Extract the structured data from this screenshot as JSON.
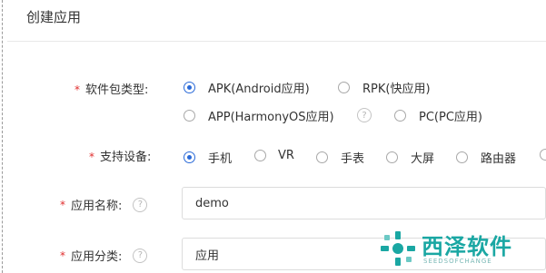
{
  "page": {
    "title": "创建应用"
  },
  "required_mark": "*",
  "package_type": {
    "label": "软件包类型:",
    "options": [
      {
        "label": "APK(Android应用)",
        "checked": true
      },
      {
        "label": "RPK(快应用)",
        "checked": false
      },
      {
        "label": "APP(HarmonyOS应用)",
        "checked": false
      },
      {
        "label": "PC(PC应用)",
        "checked": false
      }
    ],
    "help_icon": "?"
  },
  "devices": {
    "label": "支持设备:",
    "options": [
      {
        "label": "手机",
        "checked": true
      },
      {
        "label": "VR",
        "checked": false
      },
      {
        "label": "手表",
        "checked": false
      },
      {
        "label": "大屏",
        "checked": false
      },
      {
        "label": "路由器",
        "checked": false
      }
    ]
  },
  "app_name": {
    "label": "应用名称:",
    "help_icon": "?",
    "value": "demo"
  },
  "app_category": {
    "label": "应用分类:",
    "help_icon": "?",
    "value": "应用"
  },
  "watermark": {
    "brand": "西泽软件",
    "sub": "SEEDSOFCHANGE",
    "color": "#1aa7a3"
  }
}
